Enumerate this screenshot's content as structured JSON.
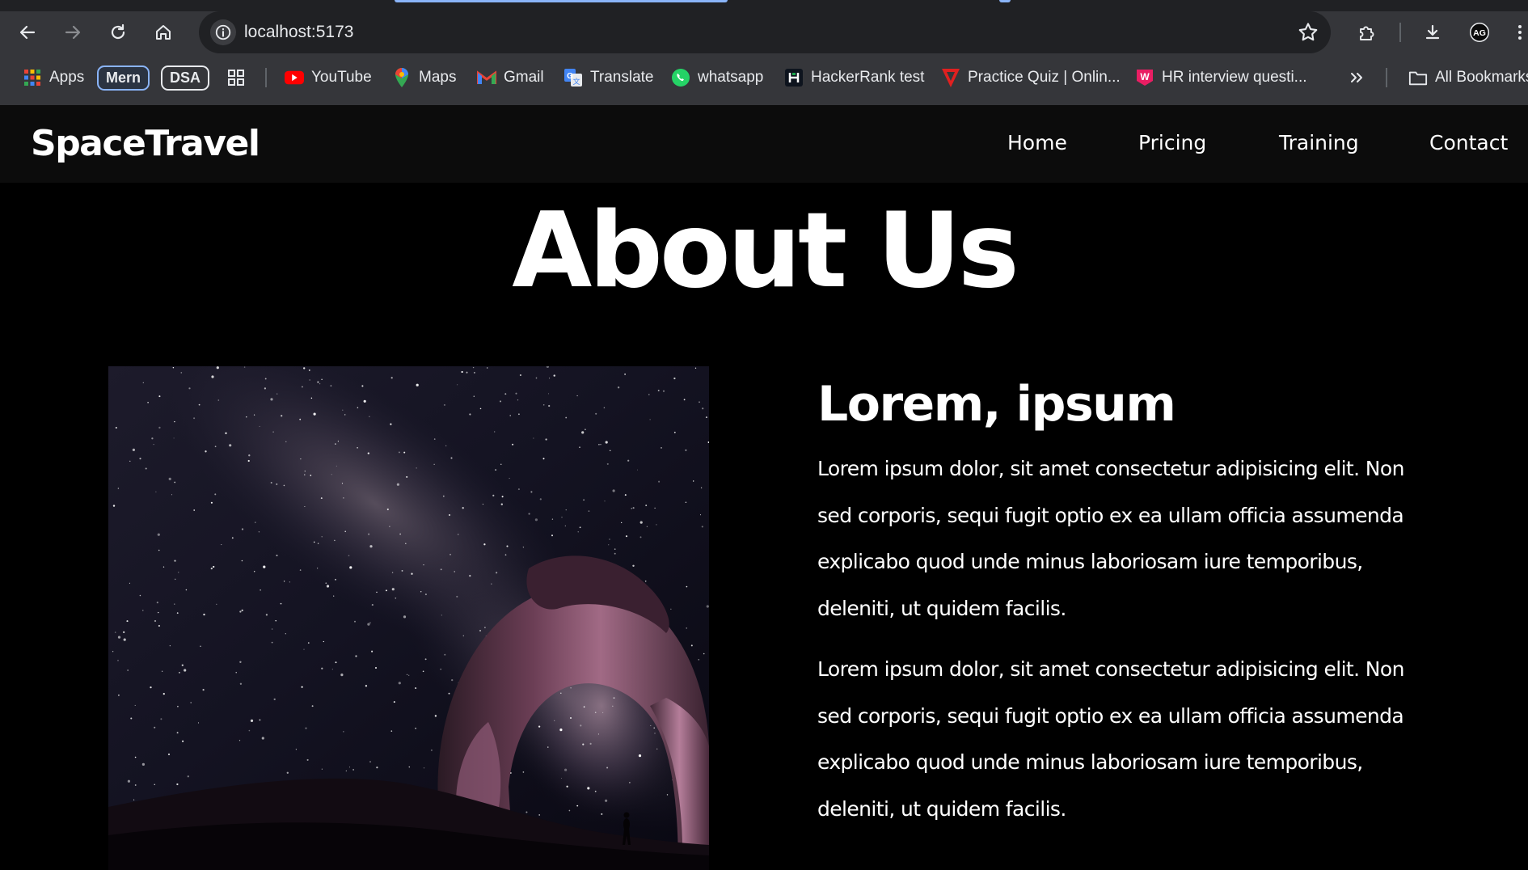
{
  "browser": {
    "url": "localhost:5173",
    "bookmarks": {
      "apps": "Apps",
      "mern": "Mern",
      "dsa": "DSA",
      "youtube": "YouTube",
      "maps": "Maps",
      "gmail": "Gmail",
      "translate": "Translate",
      "whatsapp": "whatsapp",
      "hackerrank": "HackerRank test",
      "practice_quiz": "Practice Quiz | Onlin...",
      "hr_interview": "HR interview questi...",
      "all_bookmarks": "All Bookmarks"
    }
  },
  "site": {
    "logo": "SpaceTravel",
    "nav": [
      "Home",
      "Pricing",
      "Training",
      "Contact"
    ]
  },
  "about": {
    "title": "About Us",
    "subtitle": "Lorem, ipsum",
    "paragraphs": [
      "Lorem ipsum dolor, sit amet consectetur adipisicing elit. Non sed corporis, sequi fugit optio ex ea ullam officia assumenda explicabo quod unde minus laboriosam iure temporibus, deleniti, ut quidem facilis.",
      "Lorem ipsum dolor, sit amet consectetur adipisicing elit. Non sed corporis, sequi fugit optio ex ea ullam officia assumenda explicabo quod unde minus laboriosam iure temporibus, deleniti, ut quidem facilis."
    ]
  },
  "colors": {
    "page_bg": "#000000",
    "navbar_bg": "#0c0c0c",
    "chrome_bg": "#35363a",
    "accent": "#8ab4f8"
  },
  "icons": {
    "back": "arrow-left-icon",
    "forward": "arrow-right-icon",
    "reload": "reload-icon",
    "home": "home-icon",
    "site_info": "info-icon",
    "bookmark_star": "star-icon",
    "extensions": "puzzle-icon",
    "downloads": "download-icon",
    "profile": "avatar",
    "menu": "more-vertical-icon"
  }
}
